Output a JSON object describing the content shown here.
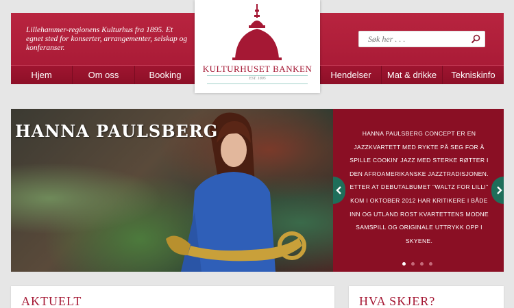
{
  "header": {
    "tagline": "Lillehammer-regionens Kulturhus fra 1895. Et egnet sted for konserter, arrangementer, selskap og konferanser."
  },
  "search": {
    "placeholder": "Søk her . . ."
  },
  "nav_left": [
    {
      "label": "Hjem"
    },
    {
      "label": "Om oss"
    },
    {
      "label": "Booking"
    }
  ],
  "nav_right": [
    {
      "label": "Hendelser"
    },
    {
      "label": "Mat &  drikke"
    },
    {
      "label": "Tekniskinfo"
    }
  ],
  "logo": {
    "title": "KULTURHUSET BANKEN",
    "est": "EST. 1895"
  },
  "slide": {
    "title": "HANNA PAULSBERG",
    "text": "Hanna Paulsberg Concept er en jazzkvartett med rykte på seg for å spille cookin' jazz med sterke røtter i den afroamerikanske jazztradisjonen. Etter at debutalbumet \"Waltz for Lilli\" kom i oktober 2012 har kritikere i både inn og utland rost kvartettens modne samspill og originale uttrykk opp i skyene.",
    "dots": 4,
    "active_dot": 1
  },
  "panels": {
    "left_title": "AKTUELT",
    "right_title": "HVA SKJER?"
  },
  "colors": {
    "brand": "#a51834",
    "slide_box": "#8a0f24",
    "arrow": "#1f6e5a"
  }
}
